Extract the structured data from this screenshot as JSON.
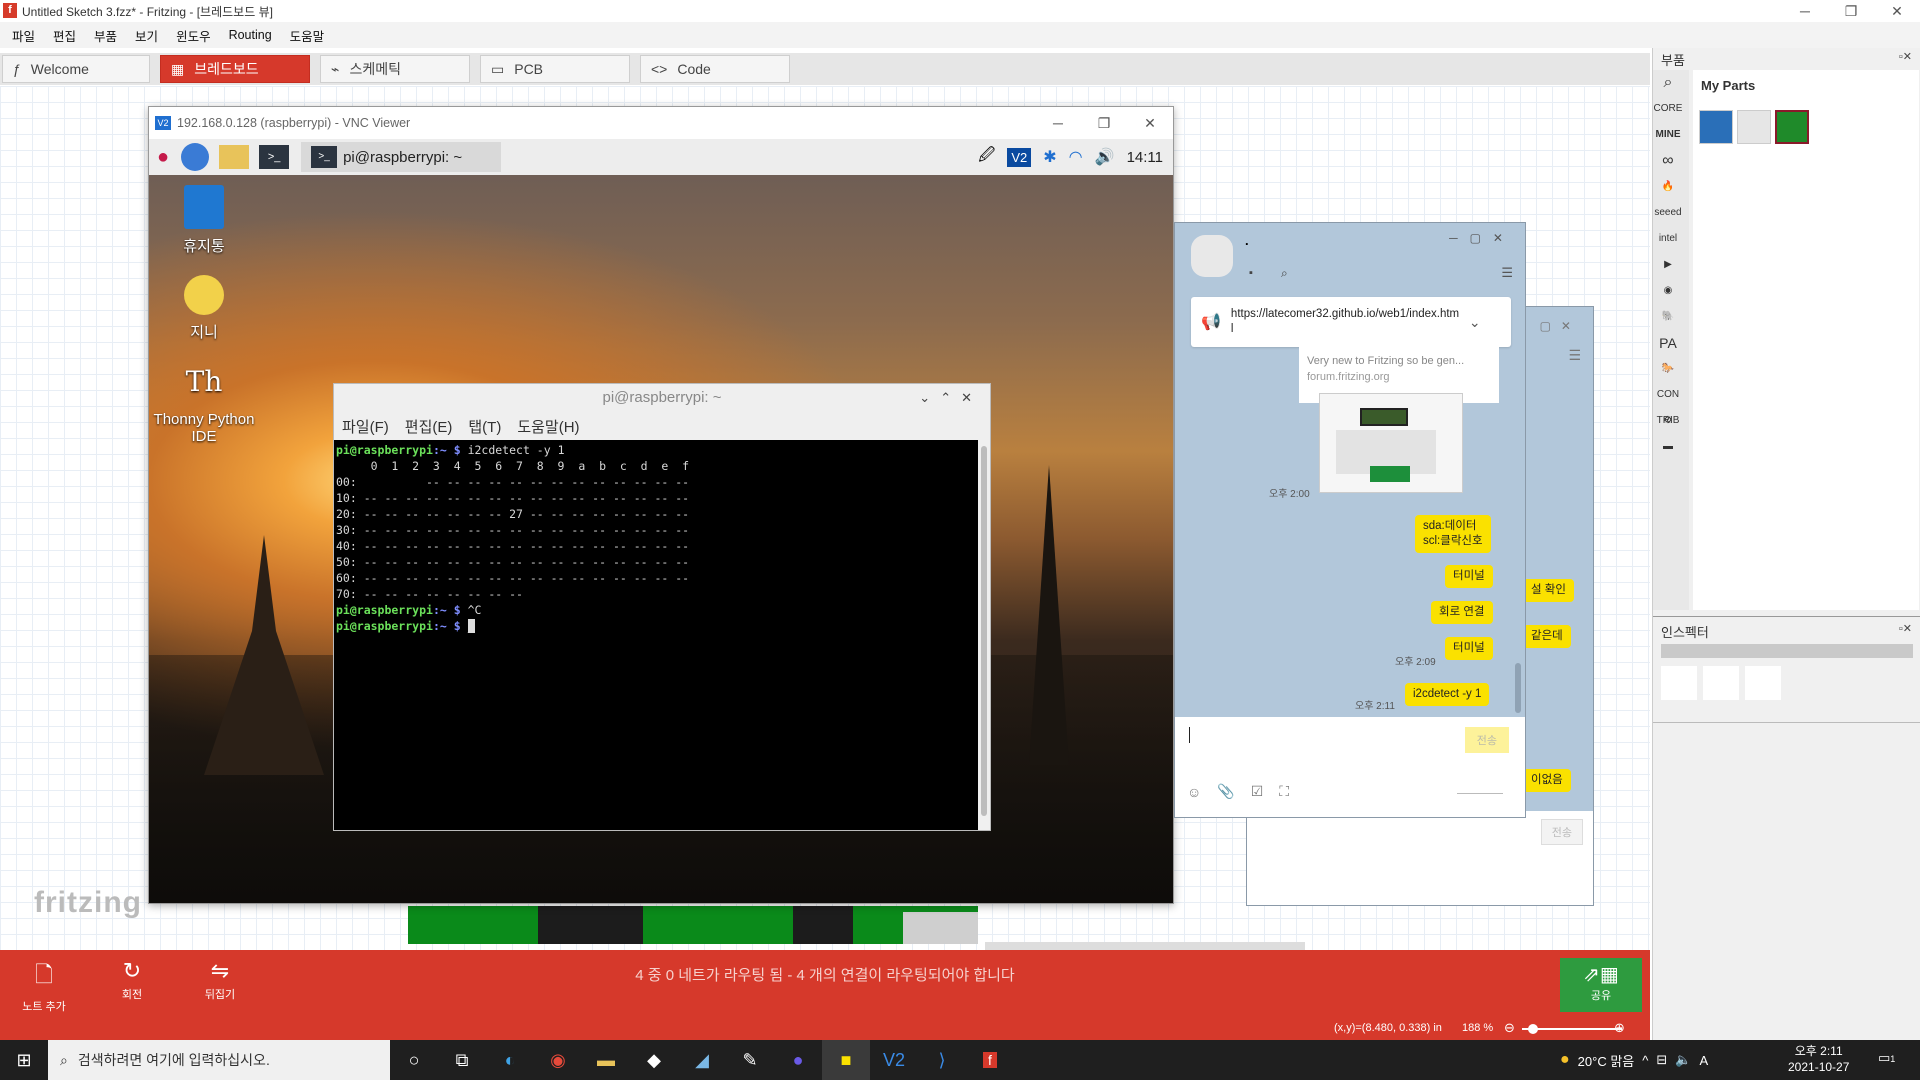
{
  "window": {
    "title": "Untitled Sketch 3.fzz* - Fritzing - [브레드보드 뷰]",
    "min": "─",
    "max": "❐",
    "close": "✕"
  },
  "menu": [
    "파일",
    "편집",
    "부품",
    "보기",
    "윈도우",
    "Routing",
    "도움말"
  ],
  "tabs": [
    {
      "label": "Welcome"
    },
    {
      "label": "브레드보드"
    },
    {
      "label": "스케메틱"
    },
    {
      "label": "PCB"
    },
    {
      "label": "Code"
    }
  ],
  "canvas": {
    "logo": "fritzing"
  },
  "vnc": {
    "title": "192.168.0.128 (raspberrypi) - VNC Viewer",
    "taskbar": {
      "terminal_label": "pi@raspberrypi: ~",
      "clock": "14:11"
    },
    "desktop_icons": [
      "휴지통",
      "지니",
      "Thonny Python IDE"
    ],
    "terminal": {
      "title": "pi@raspberrypi: ~",
      "menu": [
        "파일(F)",
        "편집(E)",
        "탭(T)",
        "도움말(H)"
      ],
      "lines": [
        "     0  1  2  3  4  5  6  7  8  9  a  b  c  d  e  f",
        "00:          -- -- -- -- -- -- -- -- -- -- -- -- --",
        "10: -- -- -- -- -- -- -- -- -- -- -- -- -- -- -- --",
        "20: -- -- -- -- -- -- -- 27 -- -- -- -- -- -- -- --",
        "30: -- -- -- -- -- -- -- -- -- -- -- -- -- -- -- --",
        "40: -- -- -- -- -- -- -- -- -- -- -- -- -- -- -- --",
        "50: -- -- -- -- -- -- -- -- -- -- -- -- -- -- -- --",
        "60: -- -- -- -- -- -- -- -- -- -- -- -- -- -- -- --",
        "70: -- -- -- -- -- -- -- --"
      ],
      "prompt_user": "pi@raspberrypi",
      "prompt_path": ":~ $",
      "cmd1": " i2cdetect -y 1",
      "cmd2": " ^C"
    }
  },
  "kakao_front": {
    "name": ".",
    "notice": "https://latecomer32.github.io/web1/index.html",
    "link_desc": "Very new to Fritzing so be gen...",
    "link_site": "forum.fritzing.org",
    "messages": [
      {
        "time": "오후 2:00"
      },
      {
        "text1": "sda:데이터",
        "text2": "scl:클락신호"
      },
      {
        "text": "터미널"
      },
      {
        "text": "회로 연결"
      },
      {
        "text": "터미널",
        "time": "오후 2:09"
      },
      {
        "text": "i2cdetect -y 1",
        "time": "오후 2:11"
      }
    ],
    "send": "전송"
  },
  "kakao_back": {
    "bubbles": [
      "설 확인",
      "같은데",
      "이없음"
    ],
    "send": "전송"
  },
  "parts": {
    "title": "부품",
    "bin": "My Parts",
    "side": [
      "CORE",
      "MINE",
      "seeed",
      "intel",
      "PA",
      "CON TRIB"
    ]
  },
  "inspector": {
    "title": "인스펙터"
  },
  "bottom": {
    "buttons": [
      "노트 추가",
      "회전",
      "뒤집기"
    ],
    "routing_status": "4 중 0 네트가 라우팅 됨 - 4 개의 연결이 라우팅되어야 합니다",
    "share": "공유"
  },
  "status": {
    "coords": "(x,y)=(8.480, 0.338) in",
    "zoom": "188 %"
  },
  "wintaskbar": {
    "search_placeholder": "검색하려면 여기에 입력하십시오.",
    "weather": "20°C  맑음",
    "time": "오후 2:11",
    "date": "2021-10-27",
    "lang": "A",
    "notif": "1"
  },
  "colors": {
    "fritzing_red": "#d6392b",
    "kakao_yellow": "#fae100",
    "kakao_bg": "#b2c7da",
    "terminal_green": "#6be05a"
  }
}
